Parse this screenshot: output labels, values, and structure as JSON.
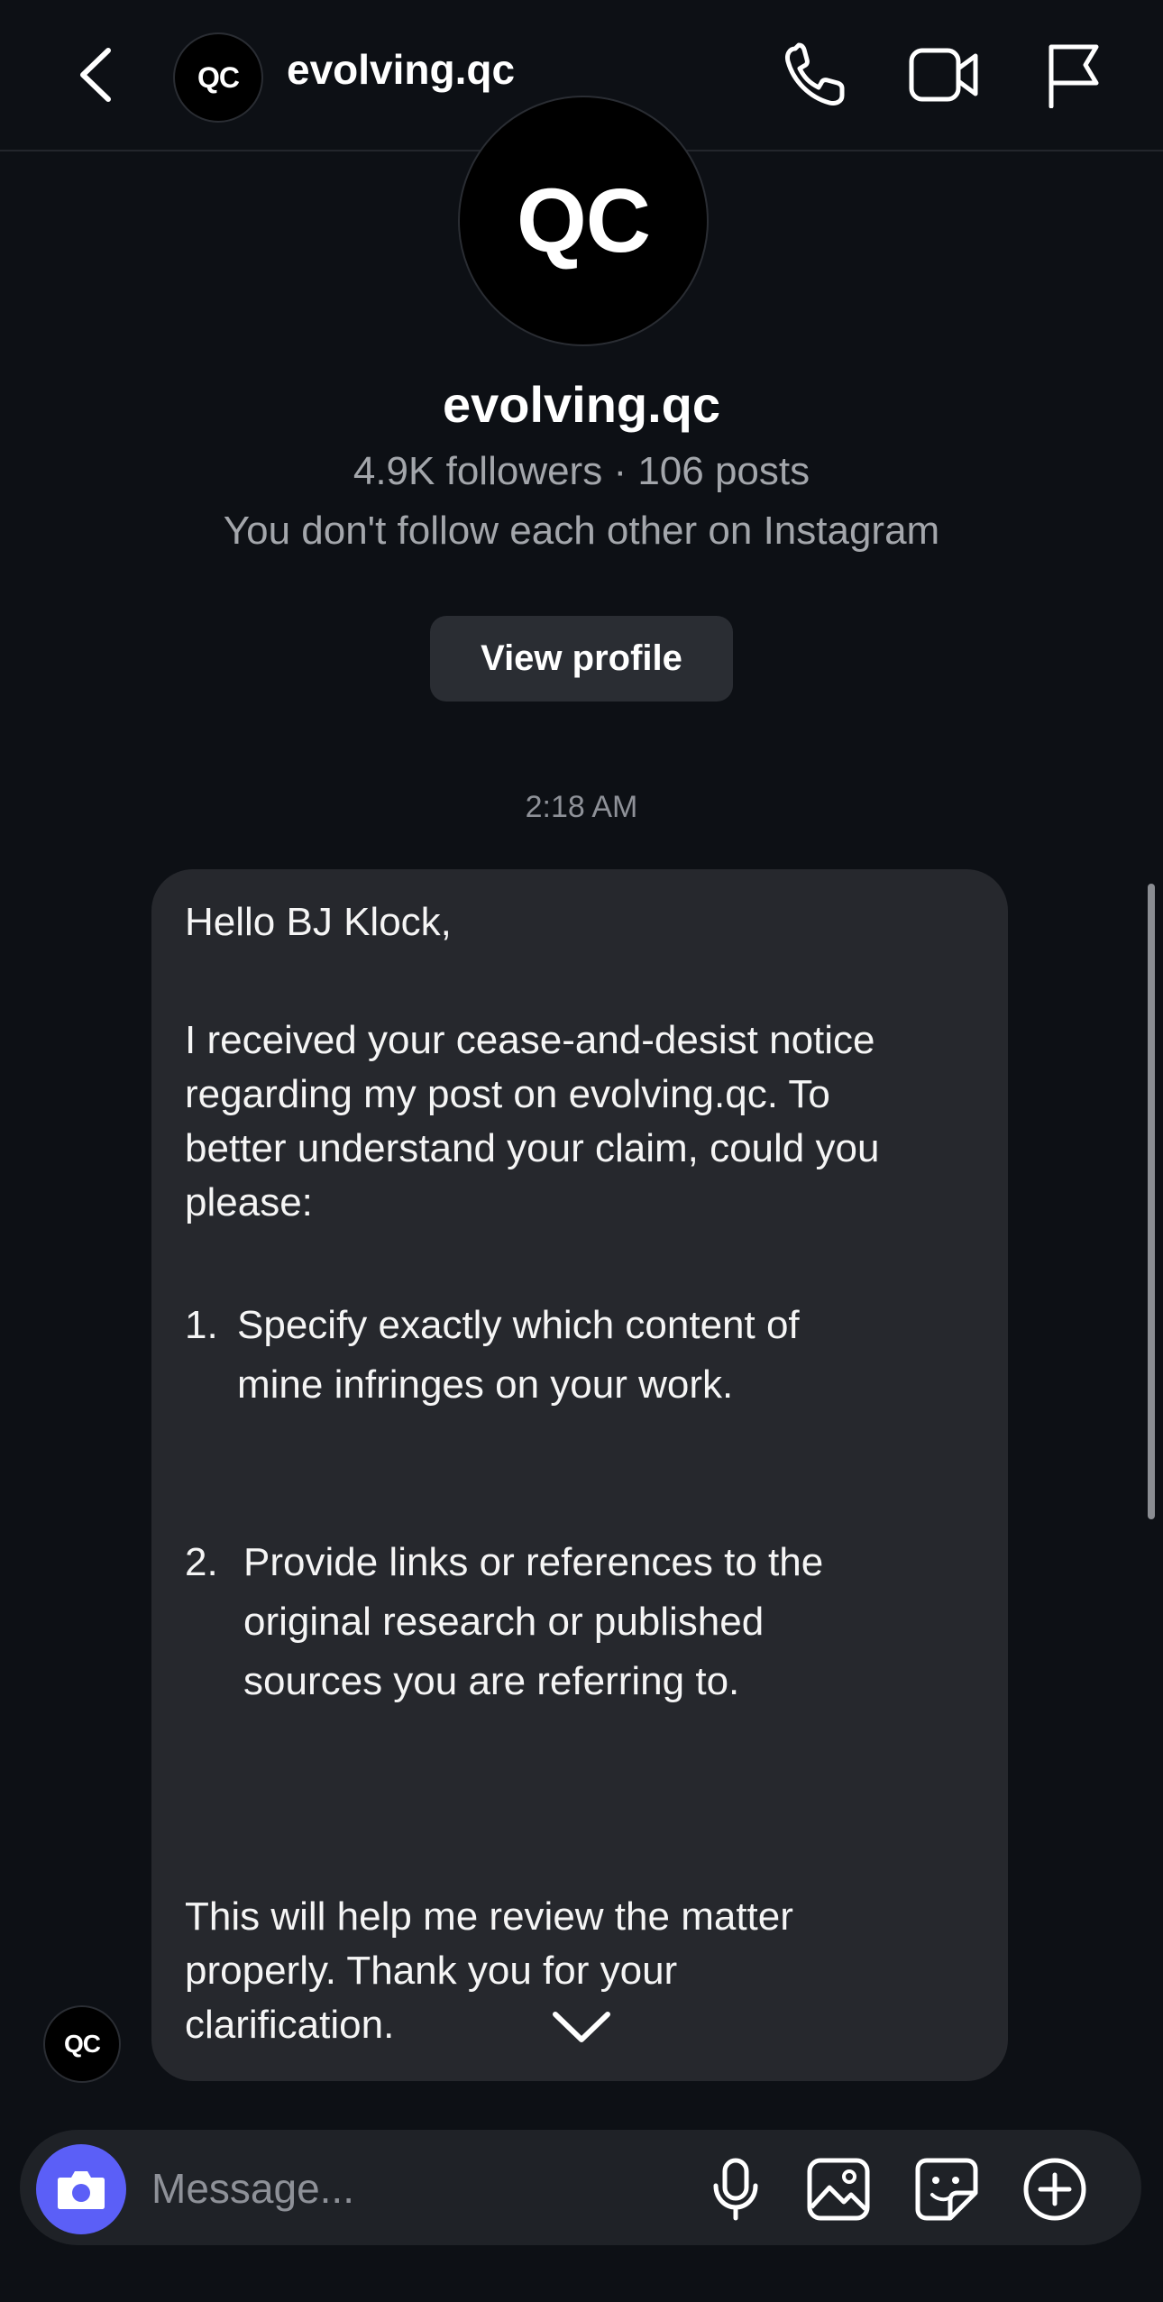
{
  "header": {
    "username": "evolving.qc",
    "avatar_text": "QC"
  },
  "profile": {
    "avatar_text": "QC",
    "name": "evolving.qc",
    "stats": "4.9K followers · 106 posts",
    "relation": "You don't follow each other on Instagram",
    "view_profile_label": "View profile"
  },
  "thread": {
    "timestamp": "2:18 AM",
    "sender_avatar_text": "QC",
    "message": {
      "greeting": "Hello BJ Klock,",
      "intro_lines": [
        "I received your cease-and-desist notice",
        "regarding my post on evolving.qc. To",
        "better understand your claim, could you",
        "please:"
      ],
      "item1_num": "1.",
      "item1_lines": [
        "Specify exactly which content of",
        "mine infringes on your work."
      ],
      "item2_num": "2.",
      "item2_lines": [
        "Provide links or references to the",
        "original research or published",
        "sources you are referring to."
      ],
      "closing_lines": [
        "This will help me review the matter",
        "properly. Thank you for your",
        "clarification."
      ]
    }
  },
  "composer": {
    "placeholder": "Message..."
  },
  "colors": {
    "background": "#0d1015",
    "bubble": "#26282d",
    "camera_button": "#5b5ff7"
  },
  "icons": [
    "back-icon",
    "phone-icon",
    "video-icon",
    "flag-icon",
    "camera-icon",
    "microphone-icon",
    "gallery-icon",
    "sticker-icon",
    "plus-icon",
    "chevron-down-icon"
  ]
}
